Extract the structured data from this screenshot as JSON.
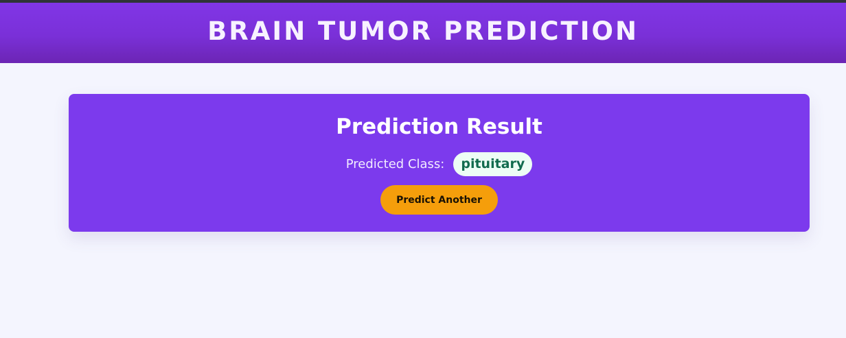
{
  "header": {
    "title": "BRAIN TUMOR PREDICTION"
  },
  "result_card": {
    "title": "Prediction Result",
    "predicted_label": "Predicted Class:",
    "predicted_value": "pituitary",
    "button_label": "Predict Another"
  },
  "colors": {
    "header_bg": "#7a30d8",
    "card_bg": "#7c3aed",
    "button_bg": "#f59e0b",
    "badge_bg": "#edfdf5",
    "badge_text": "#116b4e",
    "page_bg": "#f4f5fe"
  }
}
